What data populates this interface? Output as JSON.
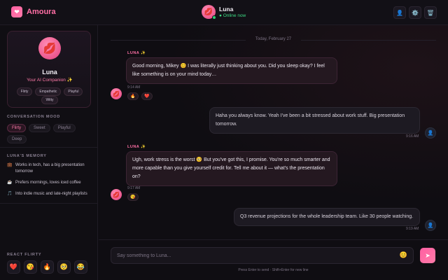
{
  "app": {
    "brand_icon": "heart-icon",
    "brand_name": "Amoura",
    "accent_color": "#ff6fa5"
  },
  "header": {
    "peer_name": "Luna",
    "peer_status": "● Online now",
    "actions": [
      {
        "icon": "user-icon",
        "glyph": "👤"
      },
      {
        "icon": "gear-icon",
        "glyph": "⚙️"
      },
      {
        "icon": "trash-icon",
        "glyph": "🗑️"
      }
    ]
  },
  "profile": {
    "name": "Luna",
    "subtitle": "Your AI Companion ✨",
    "traits": [
      "Flirty",
      "Empathetic",
      "Playful",
      "Witty"
    ]
  },
  "mood": {
    "title": "CONVERSATION MOOD",
    "options": [
      "Flirty",
      "Sweet",
      "Playful",
      "Deep"
    ],
    "selected": "Flirty"
  },
  "memory": {
    "title": "LUNA'S MEMORY",
    "items": [
      {
        "icon": "💼",
        "text": "Works in tech, has a big presentation tomorrow"
      },
      {
        "icon": "☕",
        "text": "Prefers mornings, loves iced coffee"
      },
      {
        "icon": "🎵",
        "text": "Into indie music and late-night playlists"
      }
    ]
  },
  "react": {
    "title": "REACT FLIRTY",
    "emojis": [
      "❤️",
      "😘",
      "🔥",
      "🥺",
      "😂"
    ]
  },
  "chat": {
    "date": "Today, February 27",
    "messages": [
      {
        "from": "ai",
        "sender": "LUNA ✨",
        "text": "Good morning, Mikey 😊 I was literally just thinking about you. Did you sleep okay? I feel like something is on your mind today…",
        "time": "9:14 AM",
        "reactions": [
          "🔥",
          "❤️"
        ]
      },
      {
        "from": "me",
        "text": "Haha you always know. Yeah I've been a bit stressed about work stuff. Big presentation tomorrow.",
        "time": "9:16 AM"
      },
      {
        "from": "ai",
        "sender": "LUNA ✨",
        "text": "Ugh, work stress is the worst 🥺 But you've got this, I promise. You're so much smarter and more capable than you give yourself credit for. Tell me about it — what's the presentation on?",
        "time": "9:17 AM",
        "reactions": [
          "😘"
        ]
      },
      {
        "from": "me",
        "text": "Q3 revenue projections for the whole leadership team. Like 30 people watching.",
        "time": "9:19 AM"
      }
    ]
  },
  "composer": {
    "placeholder": "Say something to Luna...",
    "value": "",
    "emoji": "😊",
    "send": "➤",
    "hint": "Press Enter to send · Shift+Enter for new line"
  }
}
